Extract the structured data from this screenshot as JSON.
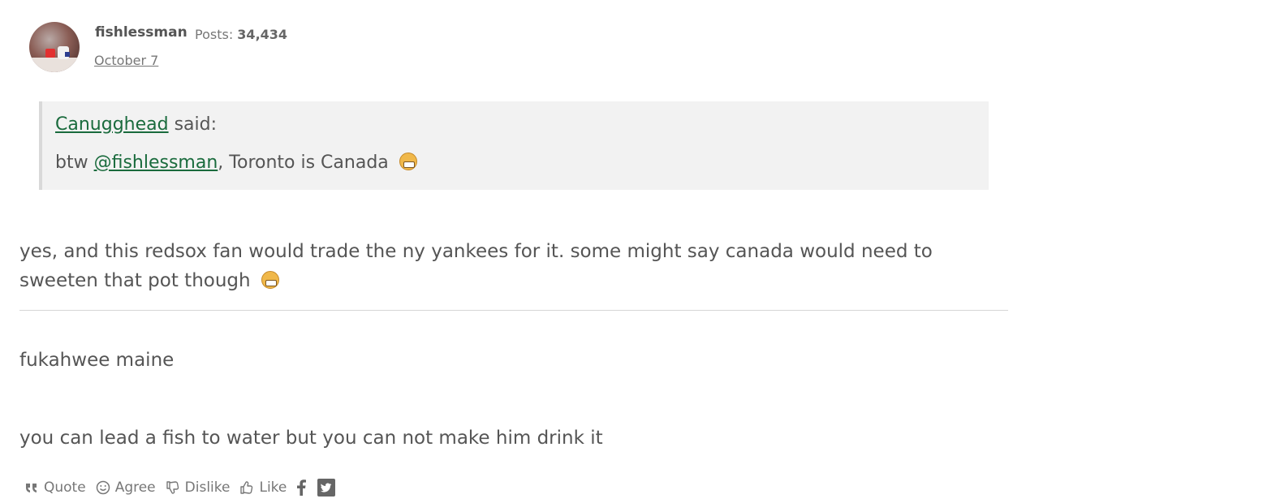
{
  "post": {
    "username": "fishlessman",
    "posts_label": "Posts:",
    "posts_count": "34,434",
    "date": "October 7"
  },
  "quote": {
    "author": "Canugghead",
    "said": "said:",
    "prefix": "btw",
    "mention": "@fishlessman",
    "rest": ", Toronto is Canada"
  },
  "reply": {
    "text": "yes, and this redsox fan would trade the ny yankees for it. some might say canada would need to sweeten that pot though"
  },
  "signature": {
    "line1": "fukahwee maine",
    "line2": "you can lead a fish to water but you can not make him drink it"
  },
  "actions": {
    "quote": "Quote",
    "agree": "Agree",
    "dislike": "Dislike",
    "like": "Like"
  },
  "icons": {
    "quote": "quote-icon",
    "agree": "smile-icon",
    "dislike": "thumbs-down-icon",
    "like": "thumbs-up-icon",
    "facebook": "facebook-icon",
    "twitter": "twitter-icon",
    "emoji": "grimacing-emoji-icon"
  },
  "colors": {
    "link": "#1a6b3d",
    "text": "#555555",
    "quote_bg": "#f2f2f2"
  }
}
